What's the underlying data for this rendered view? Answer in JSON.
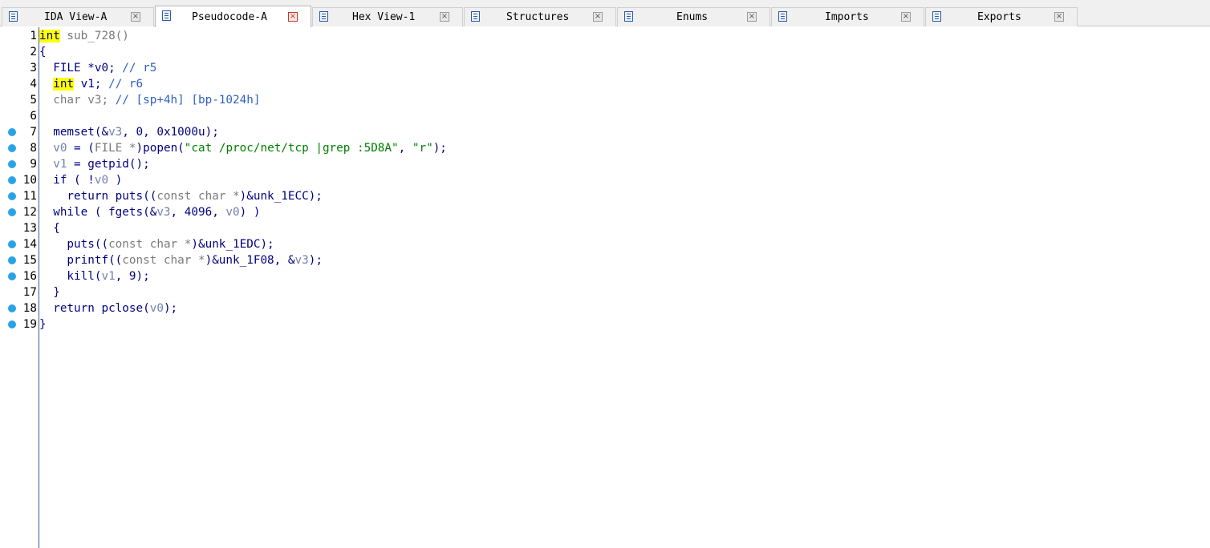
{
  "tabs": [
    {
      "label": "IDA View-A",
      "icon": "ida-view-icon",
      "active": false
    },
    {
      "label": "Pseudocode-A",
      "icon": "pseudocode-icon",
      "active": true
    },
    {
      "label": "Hex View-1",
      "icon": "hex-view-icon",
      "active": false
    },
    {
      "label": "Structures",
      "icon": "structures-icon",
      "active": false
    },
    {
      "label": "Enums",
      "icon": "enums-icon",
      "active": false
    },
    {
      "label": "Imports",
      "icon": "imports-icon",
      "active": false
    },
    {
      "label": "Exports",
      "icon": "exports-icon",
      "active": false
    }
  ],
  "close_glyph": "×",
  "colors": {
    "breakpoint": "#29a3e8",
    "highlight": "#ffff00",
    "string": "#008000",
    "keyword": "#000080",
    "variable": "#7080b0"
  },
  "lines": [
    {
      "n": "1",
      "bp": false,
      "t": [
        [
          "hl",
          "int"
        ],
        [
          "",
          ""
        ],
        [
          "typ",
          " sub_728()"
        ]
      ]
    },
    {
      "n": "2",
      "bp": false,
      "t": [
        [
          "",
          "{"
        ]
      ]
    },
    {
      "n": "3",
      "bp": false,
      "t": [
        [
          "",
          "  FILE *v0; "
        ],
        [
          "cm",
          "// r5"
        ]
      ]
    },
    {
      "n": "4",
      "bp": false,
      "t": [
        [
          "",
          "  "
        ],
        [
          "hl",
          "int"
        ],
        [
          "",
          " v1; "
        ],
        [
          "cm",
          "// r6"
        ]
      ]
    },
    {
      "n": "5",
      "bp": false,
      "t": [
        [
          "typ",
          "  char v3; "
        ],
        [
          "cm",
          "// [sp+4h] [bp-1024h]"
        ]
      ]
    },
    {
      "n": "6",
      "bp": false,
      "t": [
        [
          "",
          ""
        ]
      ]
    },
    {
      "n": "7",
      "bp": true,
      "t": [
        [
          "",
          "  memset(&"
        ],
        [
          "var",
          "v3"
        ],
        [
          "",
          ", 0, 0x1000u);"
        ]
      ]
    },
    {
      "n": "8",
      "bp": true,
      "t": [
        [
          "var",
          "  v0"
        ],
        [
          "",
          " = ("
        ],
        [
          "typ",
          "FILE *"
        ],
        [
          "",
          ")popen("
        ],
        [
          "str",
          "\"cat /proc/net/tcp |grep :5D8A\""
        ],
        [
          "",
          ", "
        ],
        [
          "str",
          "\"r\""
        ],
        [
          "",
          ");"
        ]
      ]
    },
    {
      "n": "9",
      "bp": true,
      "t": [
        [
          "var",
          "  v1"
        ],
        [
          "",
          " = getpid();"
        ]
      ]
    },
    {
      "n": "10",
      "bp": true,
      "t": [
        [
          "",
          "  if ( !"
        ],
        [
          "var",
          "v0"
        ],
        [
          "",
          " )"
        ]
      ]
    },
    {
      "n": "11",
      "bp": true,
      "t": [
        [
          "",
          "    return puts(("
        ],
        [
          "typ",
          "const char *"
        ],
        [
          "",
          ")&unk_1ECC);"
        ]
      ]
    },
    {
      "n": "12",
      "bp": true,
      "t": [
        [
          "",
          "  while ( fgets(&"
        ],
        [
          "var",
          "v3"
        ],
        [
          "",
          ", 4096, "
        ],
        [
          "var",
          "v0"
        ],
        [
          "",
          ") )"
        ]
      ]
    },
    {
      "n": "13",
      "bp": false,
      "t": [
        [
          "",
          "  {"
        ]
      ]
    },
    {
      "n": "14",
      "bp": true,
      "t": [
        [
          "",
          "    puts(("
        ],
        [
          "typ",
          "const char *"
        ],
        [
          "",
          ")&unk_1EDC);"
        ]
      ]
    },
    {
      "n": "15",
      "bp": true,
      "t": [
        [
          "",
          "    printf(("
        ],
        [
          "typ",
          "const char *"
        ],
        [
          "",
          ")&unk_1F08, &"
        ],
        [
          "var",
          "v3"
        ],
        [
          "",
          ");"
        ]
      ]
    },
    {
      "n": "16",
      "bp": true,
      "t": [
        [
          "",
          "    kill("
        ],
        [
          "var",
          "v1"
        ],
        [
          "",
          ", 9);"
        ]
      ]
    },
    {
      "n": "17",
      "bp": false,
      "t": [
        [
          "",
          "  }"
        ]
      ]
    },
    {
      "n": "18",
      "bp": true,
      "t": [
        [
          "",
          "  return pclose("
        ],
        [
          "var",
          "v0"
        ],
        [
          "",
          ");"
        ]
      ]
    },
    {
      "n": "19",
      "bp": true,
      "t": [
        [
          "",
          "}"
        ]
      ]
    }
  ]
}
